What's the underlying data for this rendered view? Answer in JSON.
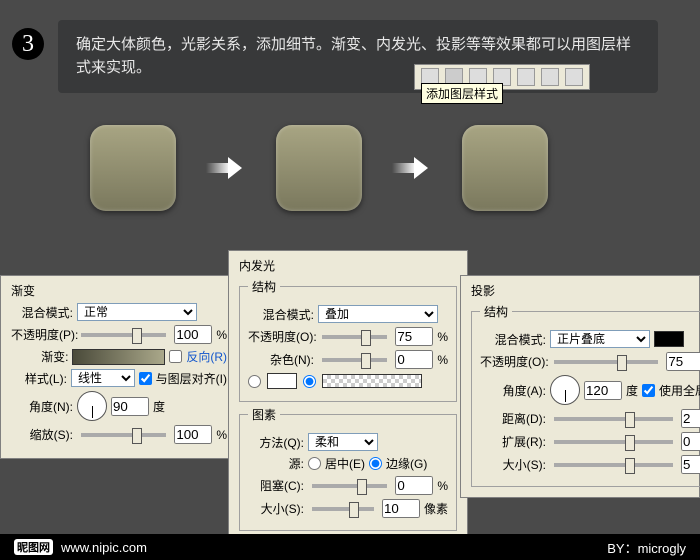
{
  "step_number": "3",
  "description": "确定大体颜色，光影关系，添加细节。渐变、内发光、投影等等效果都可以用图层样式来实现。",
  "tooltip": "添加图层样式",
  "panels": {
    "gradient": {
      "title": "渐变",
      "blend_label": "混合模式:",
      "blend_value": "正常",
      "opacity_label": "不透明度(P):",
      "opacity_value": "100",
      "pct": "%",
      "grad_label": "渐变:",
      "reverse_label": "反向(R)",
      "style_label": "样式(L):",
      "style_value": "线性",
      "align_label": "与图层对齐(I)",
      "angle_label": "角度(N):",
      "angle_value": "90",
      "angle_unit": "度",
      "scale_label": "缩放(S):",
      "scale_value": "100"
    },
    "glow": {
      "title": "内发光",
      "struct_legend": "结构",
      "blend_label": "混合模式:",
      "blend_value": "叠加",
      "opacity_label": "不透明度(O):",
      "opacity_value": "75",
      "pct": "%",
      "noise_label": "杂色(N):",
      "noise_value": "0",
      "elem_legend": "图素",
      "method_label": "方法(Q):",
      "method_value": "柔和",
      "source_label": "源:",
      "source_center": "居中(E)",
      "source_edge": "边缘(G)",
      "choke_label": "阻塞(C):",
      "choke_value": "0",
      "size_label": "大小(S):",
      "size_value": "10",
      "size_unit": "像素"
    },
    "shadow": {
      "title": "投影",
      "struct_legend": "结构",
      "blend_label": "混合模式:",
      "blend_value": "正片叠底",
      "opacity_label": "不透明度(O):",
      "opacity_value": "75",
      "pct": "%",
      "angle_label": "角度(A):",
      "angle_value": "120",
      "angle_unit": "度",
      "global_label": "使用全局光",
      "distance_label": "距离(D):",
      "distance_value": "2",
      "spread_label": "扩展(R):",
      "spread_value": "0",
      "size_label": "大小(S):",
      "size_value": "5"
    }
  },
  "footer": {
    "logo_text": "昵图网",
    "url": "www.nipic.com",
    "by_label": "BY：",
    "author": "microgly"
  }
}
